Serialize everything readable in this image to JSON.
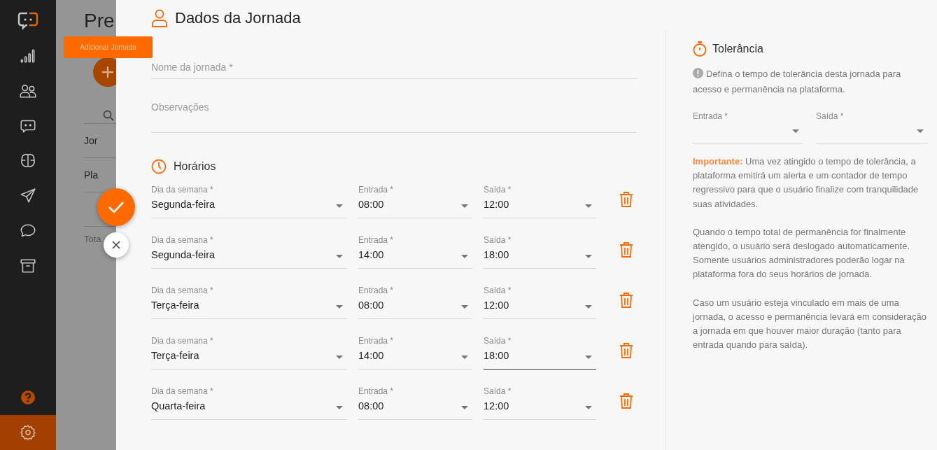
{
  "sidebar": {
    "items": [
      {
        "kind": "logo",
        "selected": false
      },
      {
        "kind": "signal",
        "selected": false
      },
      {
        "kind": "users",
        "selected": false
      },
      {
        "kind": "bot",
        "selected": false
      },
      {
        "kind": "brain",
        "selected": false
      },
      {
        "kind": "send",
        "selected": false
      },
      {
        "kind": "chat",
        "selected": false
      },
      {
        "kind": "archive",
        "selected": false
      }
    ],
    "bottom_items": [
      {
        "kind": "help",
        "selected": false
      },
      {
        "kind": "settings",
        "selected": true
      }
    ]
  },
  "background_page": {
    "title": "Pre",
    "tooltip": "Adicionar Jornada",
    "rows": [
      "Jor",
      "Pla"
    ],
    "footer": "Tota"
  },
  "form": {
    "title": "Dados da Jornada",
    "fields": [
      {
        "placeholder": "Nome da jornada *",
        "kind": "input"
      },
      {
        "placeholder": "Observações",
        "kind": "textarea"
      }
    ],
    "schedule_title": "Horários",
    "schedule": [
      {
        "day": {
          "label": "Dia da semana *",
          "value": "Segunda-feira",
          "focused": false
        },
        "start": {
          "label": "Entrada *",
          "value": "08:00",
          "focused": false
        },
        "end": {
          "label": "Saída *",
          "value": "12:00",
          "focused": false
        }
      },
      {
        "day": {
          "label": "Dia da semana *",
          "value": "Segunda-feira",
          "focused": false
        },
        "start": {
          "label": "Entrada *",
          "value": "14:00",
          "focused": false
        },
        "end": {
          "label": "Saída *",
          "value": "18:00",
          "focused": false
        }
      },
      {
        "day": {
          "label": "Dia da semana *",
          "value": "Terça-feira",
          "focused": false
        },
        "start": {
          "label": "Entrada *",
          "value": "08:00",
          "focused": false
        },
        "end": {
          "label": "Saída *",
          "value": "12:00",
          "focused": false
        }
      },
      {
        "day": {
          "label": "Dia da semana *",
          "value": "Terça-feira",
          "focused": false
        },
        "start": {
          "label": "Entrada *",
          "value": "14:00",
          "focused": false
        },
        "end": {
          "label": "Saída *",
          "value": "18:00",
          "focused": true
        }
      },
      {
        "day": {
          "label": "Dia da semana *",
          "value": "Quarta-feira",
          "focused": false
        },
        "start": {
          "label": "Entrada *",
          "value": "08:00",
          "focused": false
        },
        "end": {
          "label": "Saída *",
          "value": "12:00",
          "focused": false
        }
      }
    ]
  },
  "tolerance": {
    "title": "Tolerância",
    "info": "Defina o tempo de tolerância desta jornada para acesso e permanência na plataforma.",
    "fields": [
      {
        "label": "Entrada *"
      },
      {
        "label": "Saída *"
      }
    ],
    "paragraphs": [
      "**Importante:** Uma vez atingido o tempo de tolerância, a plataforma emitirá um alerta e um contador de tempo regressivo para que o usuário finalize com tranquilidade suas atividades.",
      "Quando o tempo total de permanência for finalmente atengido, o usuário será deslogado automaticamente. Somente usuários administradores poderão logar na plataforma fora do seus horários de jornada.",
      "Caso um usuário esteja vinculado em mais de uma jornada, o acesso e permanência levará em consideração a jornada em que houver maior duração (tanto para entrada quando para saída)."
    ]
  }
}
